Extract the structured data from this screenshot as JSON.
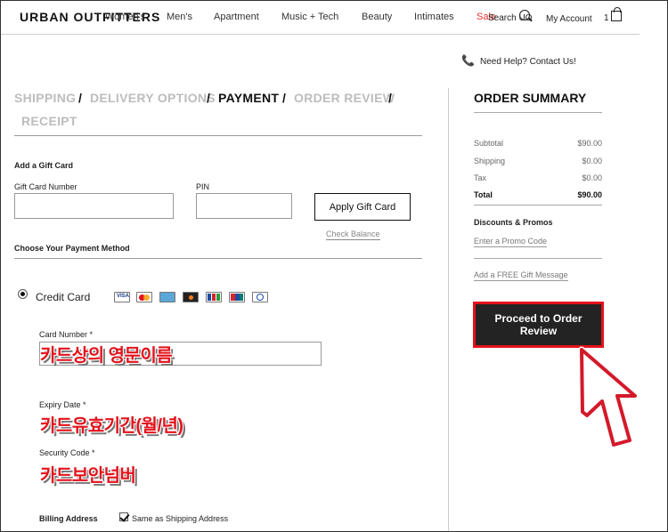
{
  "header": {
    "logo": "URBAN OUTFITTERS",
    "nav": [
      {
        "label": "Women's"
      },
      {
        "label": "Men's"
      },
      {
        "label": "Apartment"
      },
      {
        "label": "Music + Tech"
      },
      {
        "label": "Beauty"
      },
      {
        "label": "Intimates"
      },
      {
        "label": "Sale"
      }
    ],
    "search_label": "Search UO",
    "account_label": "My Account",
    "cart_count": "1"
  },
  "help": "Need Help? Contact Us!",
  "steps": [
    {
      "label": "SHIPPING",
      "state": "done"
    },
    {
      "label": "DELIVERY OPTIONS",
      "state": "done"
    },
    {
      "label": "PAYMENT",
      "state": "active"
    },
    {
      "label": "ORDER REVIEW",
      "state": "pending"
    },
    {
      "label": "RECEIPT",
      "state": "pending"
    }
  ],
  "step_separator": "/",
  "gift_card": {
    "heading": "Add a Gift Card",
    "number_label": "Gift Card Number",
    "number_value": "",
    "pin_label": "PIN",
    "pin_value": "",
    "apply_button": "Apply Gift Card",
    "check_balance": "Check Balance"
  },
  "payment": {
    "heading": "Choose Your Payment Method",
    "method": "Credit Card",
    "card_logos": [
      "visa-icon",
      "mastercard-icon",
      "amex-icon",
      "discover-icon",
      "jcb-icon",
      "unionpay-icon",
      "diners-icon"
    ],
    "card_number_label": "Card Number *",
    "card_number_note": "카드상의 영문이름",
    "expiry_label": "Expiry Date *",
    "expiry_note": "카드유효기간(월/년)",
    "security_label": "Security Code *",
    "security_note": "카드보안넘버",
    "billing_label": "Billing Address",
    "same_as_shipping": "Same as Shipping Address"
  },
  "summary": {
    "title": "ORDER SUMMARY",
    "rows": [
      {
        "label": "Subtotal",
        "value": "$90.00"
      },
      {
        "label": "Shipping",
        "value": "$0.00"
      },
      {
        "label": "Tax",
        "value": "$0.00"
      },
      {
        "label": "Total",
        "value": "$90.00"
      }
    ],
    "discounts_heading": "Discounts & Promos",
    "promo_link": "Enter a Promo Code",
    "gift_message_link": "Add a FREE Gift Message",
    "proceed_button": "Proceed to Order Review"
  },
  "colors": {
    "accent_red": "#e3121b",
    "sale_red": "#e0332e",
    "button_dark": "#232323"
  }
}
